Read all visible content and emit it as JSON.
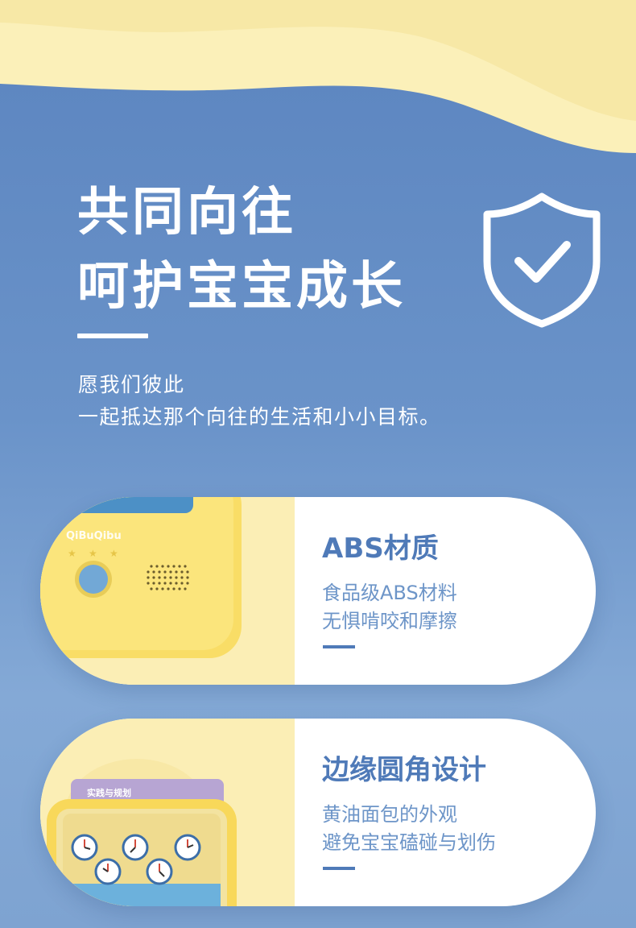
{
  "hero": {
    "title_line1": "共同向往",
    "title_line2": "呵护宝宝成长",
    "subtitle_line1": "愿我们彼此",
    "subtitle_line2": "一起抵达那个向往的生活和小小目标。"
  },
  "features": [
    {
      "title": "ABS材质",
      "desc_line1": "食品级ABS材料",
      "desc_line2": "无惧啃咬和摩擦",
      "photo_brand": "QiBuQibu"
    },
    {
      "title": "边缘圆角设计",
      "desc_line1": "黄油面包的外观",
      "desc_line2": "避免宝宝磕碰与划伤",
      "photo_label": "实践与规划"
    }
  ],
  "colors": {
    "background": "#6a93c9",
    "wave": "#f7e9a7",
    "accent": "#4f7ab8",
    "card": "#ffffff"
  },
  "icons": {
    "hero": "shield-check-icon"
  }
}
